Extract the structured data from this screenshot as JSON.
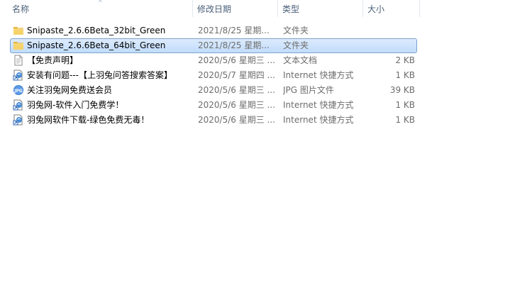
{
  "columns": {
    "name": "名称",
    "date": "修改日期",
    "type": "类型",
    "size": "大小"
  },
  "files": [
    {
      "name": "Snipaste_2.6.6Beta_32bit_Green",
      "date": "2021/8/25 星期...",
      "type": "文件夹",
      "size": "",
      "icon": "folder-icon",
      "selected": false
    },
    {
      "name": "Snipaste_2.6.6Beta_64bit_Green",
      "date": "2021/8/25 星期...",
      "type": "文件夹",
      "size": "",
      "icon": "folder-icon",
      "selected": true
    },
    {
      "name": "【免责声明】",
      "date": "2020/5/6 星期三 ...",
      "type": "文本文档",
      "size": "2 KB",
      "icon": "text-file-icon",
      "selected": false
    },
    {
      "name": "安装有问题---【上羽兔问答搜索答案】",
      "date": "2020/5/7 星期四 ...",
      "type": "Internet 快捷方式",
      "size": "1 KB",
      "icon": "shortcut-icon",
      "selected": false
    },
    {
      "name": "关注羽兔网免费送会员",
      "date": "2020/5/6 星期三 ...",
      "type": "JPG 图片文件",
      "size": "39 KB",
      "icon": "jpg-file-icon",
      "selected": false
    },
    {
      "name": "羽兔网-软件入门免费学！",
      "date": "2020/5/6 星期三 ...",
      "type": "Internet 快捷方式",
      "size": "1 KB",
      "icon": "shortcut-icon",
      "selected": false
    },
    {
      "name": "羽兔网软件下载-绿色免费无毒！",
      "date": "2020/5/6 星期三 ...",
      "type": "Internet 快捷方式",
      "size": "1 KB",
      "icon": "shortcut-icon",
      "selected": false
    }
  ]
}
